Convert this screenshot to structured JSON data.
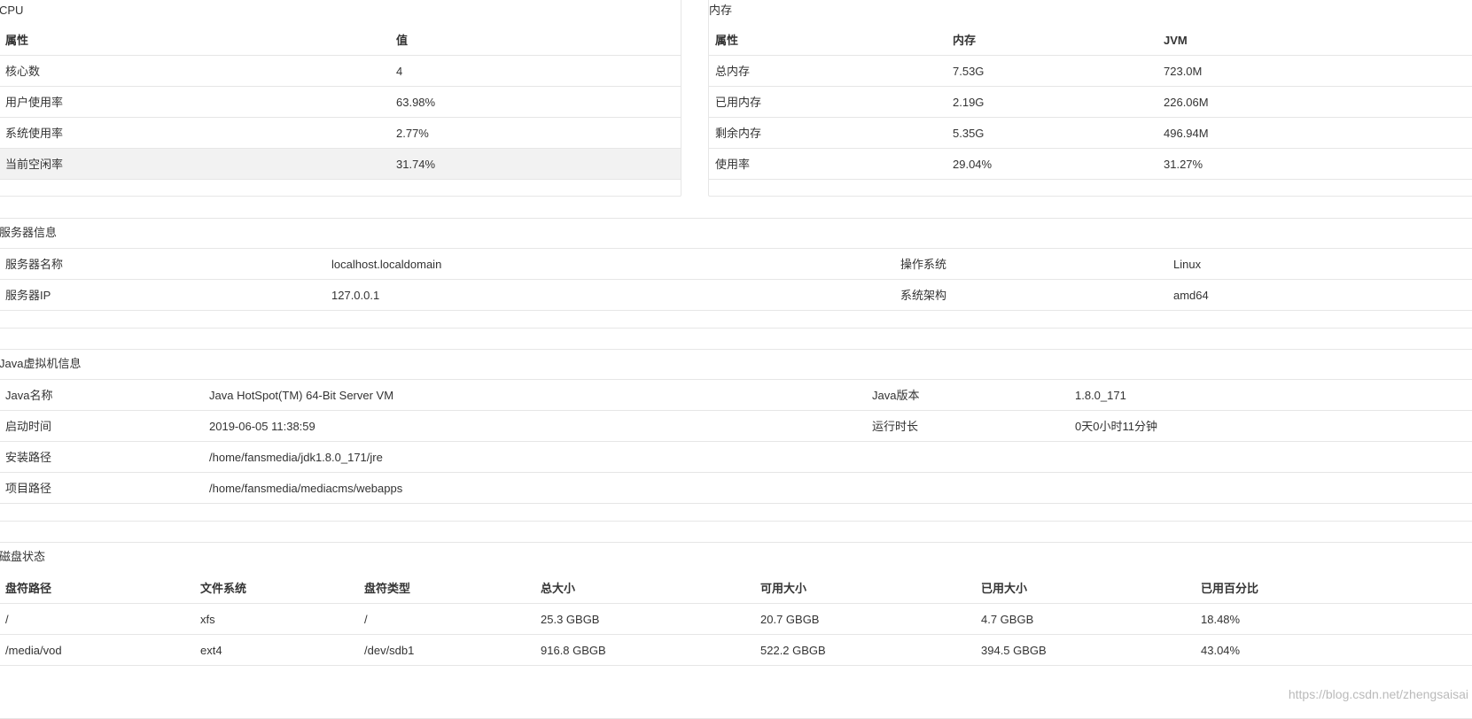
{
  "cpu": {
    "title": "CPU",
    "headers": [
      "属性",
      "值"
    ],
    "rows": [
      [
        "核心数",
        "4"
      ],
      [
        "用户使用率",
        "63.98%"
      ],
      [
        "系统使用率",
        "2.77%"
      ],
      [
        "当前空闲率",
        "31.74%"
      ]
    ]
  },
  "memory": {
    "title": "内存",
    "headers": [
      "属性",
      "内存",
      "JVM"
    ],
    "rows": [
      [
        "总内存",
        "7.53G",
        "723.0M"
      ],
      [
        "已用内存",
        "2.19G",
        "226.06M"
      ],
      [
        "剩余内存",
        "5.35G",
        "496.94M"
      ],
      [
        "使用率",
        "29.04%",
        "31.27%"
      ]
    ]
  },
  "server": {
    "title": "服务器信息",
    "rows": [
      [
        "服务器名称",
        "localhost.localdomain",
        "操作系统",
        "Linux"
      ],
      [
        "服务器IP",
        "127.0.0.1",
        "系统架构",
        "amd64"
      ]
    ]
  },
  "jvm": {
    "title": "Java虚拟机信息",
    "rows": [
      [
        "Java名称",
        "Java HotSpot(TM) 64-Bit Server VM",
        "Java版本",
        "1.8.0_171"
      ],
      [
        "启动时间",
        "2019-06-05 11:38:59",
        "运行时长",
        "0天0小时11分钟"
      ],
      [
        "安装路径",
        "/home/fansmedia/jdk1.8.0_171/jre",
        "",
        ""
      ],
      [
        "项目路径",
        "/home/fansmedia/mediacms/webapps",
        "",
        ""
      ]
    ]
  },
  "disk": {
    "title": "磁盘状态",
    "headers": [
      "盘符路径",
      "文件系统",
      "盘符类型",
      "总大小",
      "可用大小",
      "已用大小",
      "已用百分比"
    ],
    "rows": [
      [
        "/",
        "xfs",
        "/",
        "25.3 GBGB",
        "20.7 GBGB",
        "4.7 GBGB",
        "18.48%"
      ],
      [
        "/media/vod",
        "ext4",
        "/dev/sdb1",
        "916.8 GBGB",
        "522.2 GBGB",
        "394.5 GBGB",
        "43.04%"
      ]
    ]
  },
  "watermark": "https://blog.csdn.net/zhengsaisai"
}
